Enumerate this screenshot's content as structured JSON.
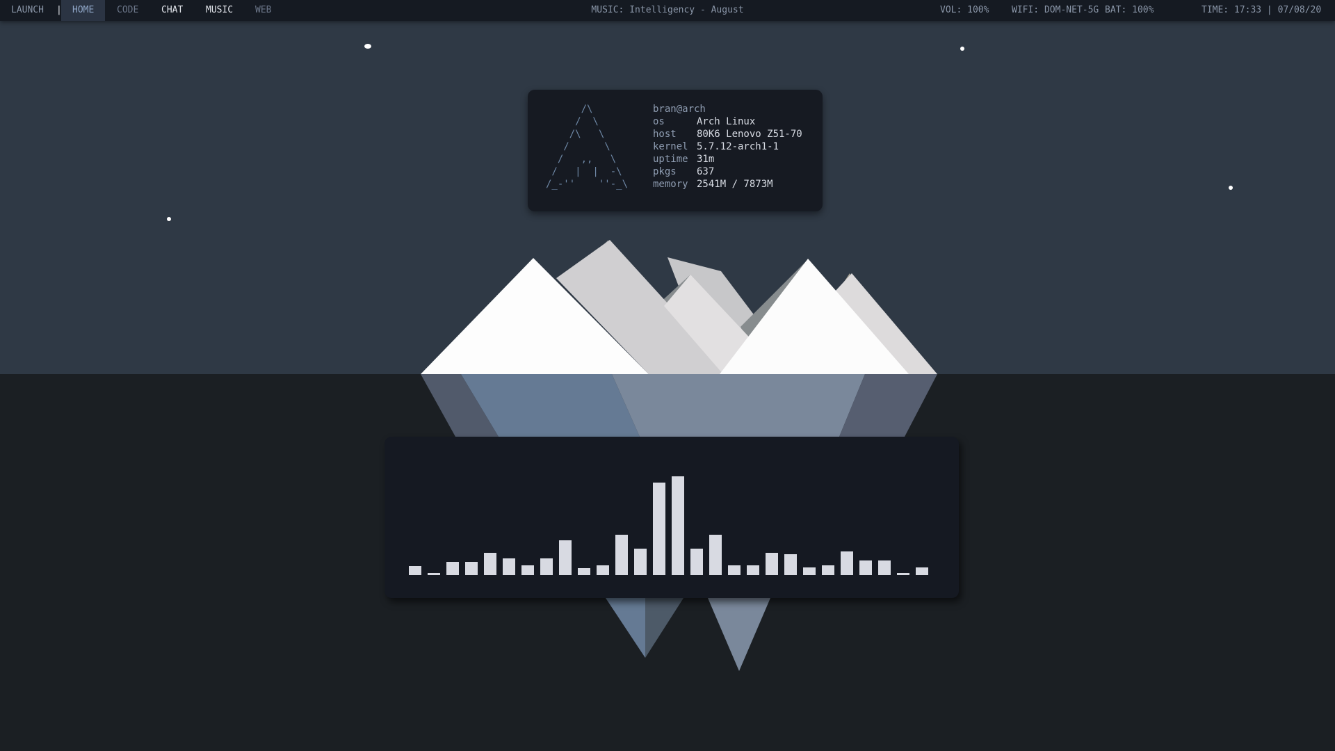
{
  "topbar": {
    "launch_label": "LAUNCH",
    "separator": "|",
    "workspaces": [
      "HOME",
      "CODE",
      "CHAT",
      "MUSIC",
      "WEB"
    ],
    "music": "MUSIC: Intelligency - August",
    "volume": "VOL: 100%",
    "wifi": "WIFI: DOM-NET-5G",
    "battery": "BAT: 100%",
    "time": "TIME: 17:33 | 07/08/20"
  },
  "neofetch": {
    "ascii_logo": "      /\\\n     /  \\\n    /\\   \\\n   /      \\\n  /   ,,   \\\n /   |  |  -\\\n/_-''    ''-_\\",
    "user": "bran@arch",
    "rows": [
      {
        "key": "os",
        "value": "Arch Linux"
      },
      {
        "key": "host",
        "value": "80K6 Lenovo Z51-70"
      },
      {
        "key": "kernel",
        "value": "5.7.12-arch1-1"
      },
      {
        "key": "uptime",
        "value": "31m"
      },
      {
        "key": "pkgs",
        "value": "637"
      },
      {
        "key": "memory",
        "value": "2541M / 7873M"
      }
    ]
  },
  "visualizer": {
    "levels": [
      0.08,
      0.02,
      0.12,
      0.12,
      0.2,
      0.15,
      0.09,
      0.15,
      0.31,
      0.06,
      0.09,
      0.36,
      0.24,
      0.83,
      0.89,
      0.24,
      0.36,
      0.09,
      0.09,
      0.2,
      0.19,
      0.07,
      0.09,
      0.21,
      0.13,
      0.13,
      0.02,
      0.07
    ]
  },
  "colors": {
    "sky": "#2f3945",
    "water": "#1b1f23",
    "bar_background": "#151a22",
    "active_workspace": "#2b3443",
    "panel_background": "#161a22",
    "snow": "#ffffff",
    "ice_blue": "#657a94",
    "visualizer_bar": "#d8dae2"
  }
}
